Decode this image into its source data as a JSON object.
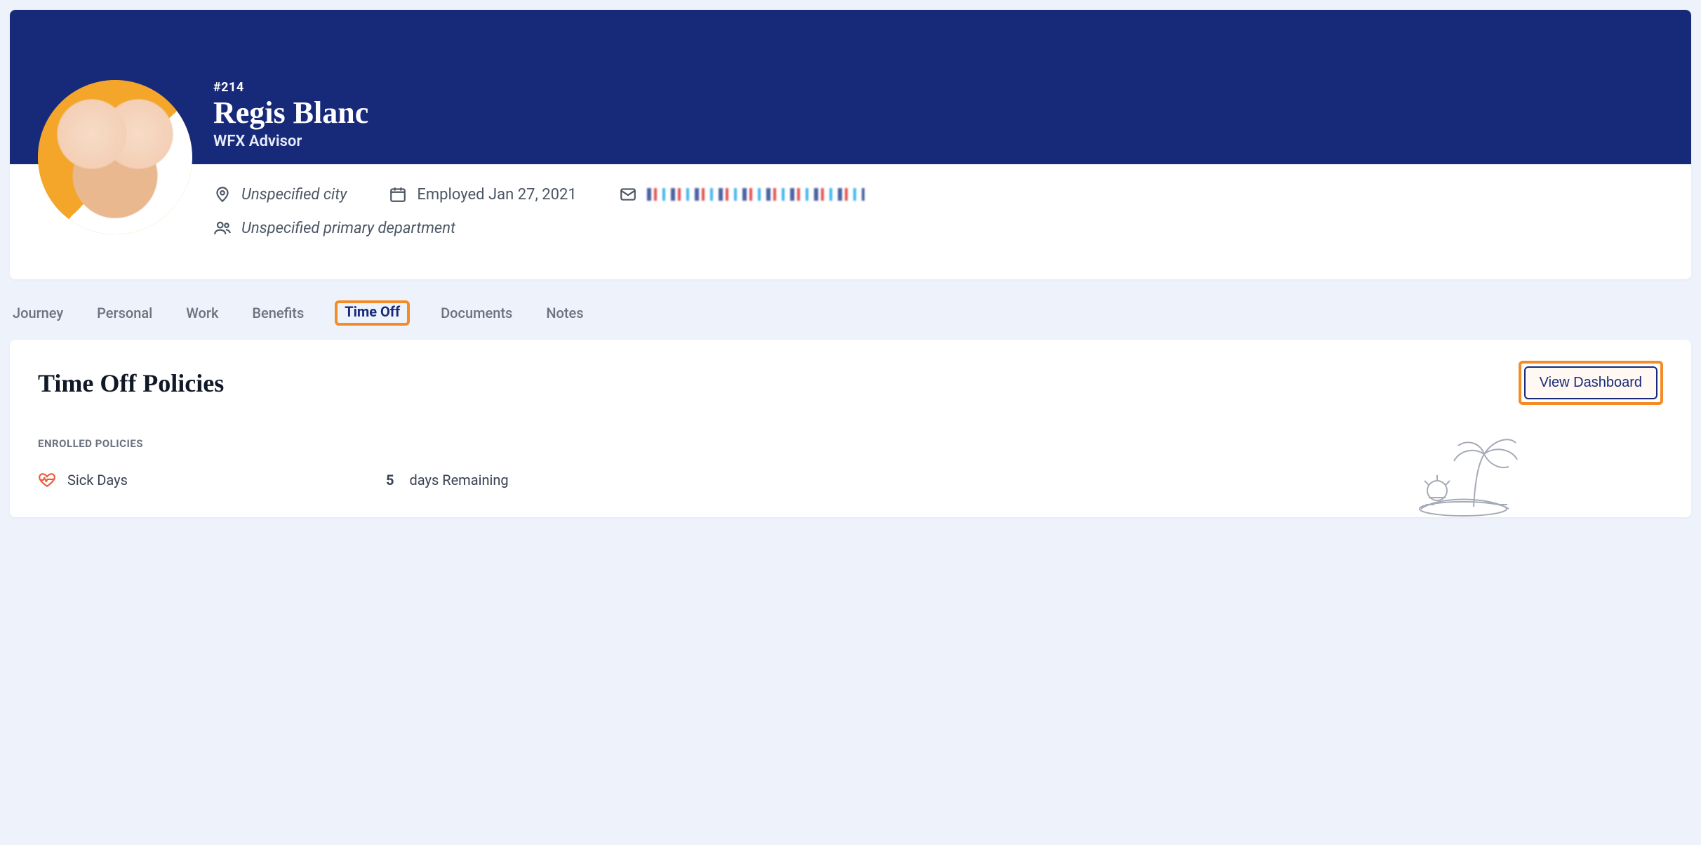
{
  "header": {
    "employee_id": "#214",
    "name": "Regis Blanc",
    "title": "WFX Advisor",
    "city": "Unspecified city",
    "employed": "Employed Jan 27, 2021",
    "department": "Unspecified primary department",
    "email_obscured": true
  },
  "tabs": [
    {
      "label": "Journey",
      "active": false
    },
    {
      "label": "Personal",
      "active": false
    },
    {
      "label": "Work",
      "active": false
    },
    {
      "label": "Benefits",
      "active": false
    },
    {
      "label": "Time Off",
      "active": true
    },
    {
      "label": "Documents",
      "active": false
    },
    {
      "label": "Notes",
      "active": false
    }
  ],
  "main": {
    "section_title": "Time Off Policies",
    "view_dashboard_label": "View Dashboard",
    "enrolled_label": "Enrolled Policies",
    "policies": [
      {
        "name": "Sick Days",
        "days": "5",
        "suffix": "days Remaining",
        "icon": "heartbeat"
      }
    ]
  },
  "colors": {
    "brand_navy": "#172a7a",
    "highlight_orange": "#f58b26",
    "accent_red": "#ef5b3c"
  }
}
